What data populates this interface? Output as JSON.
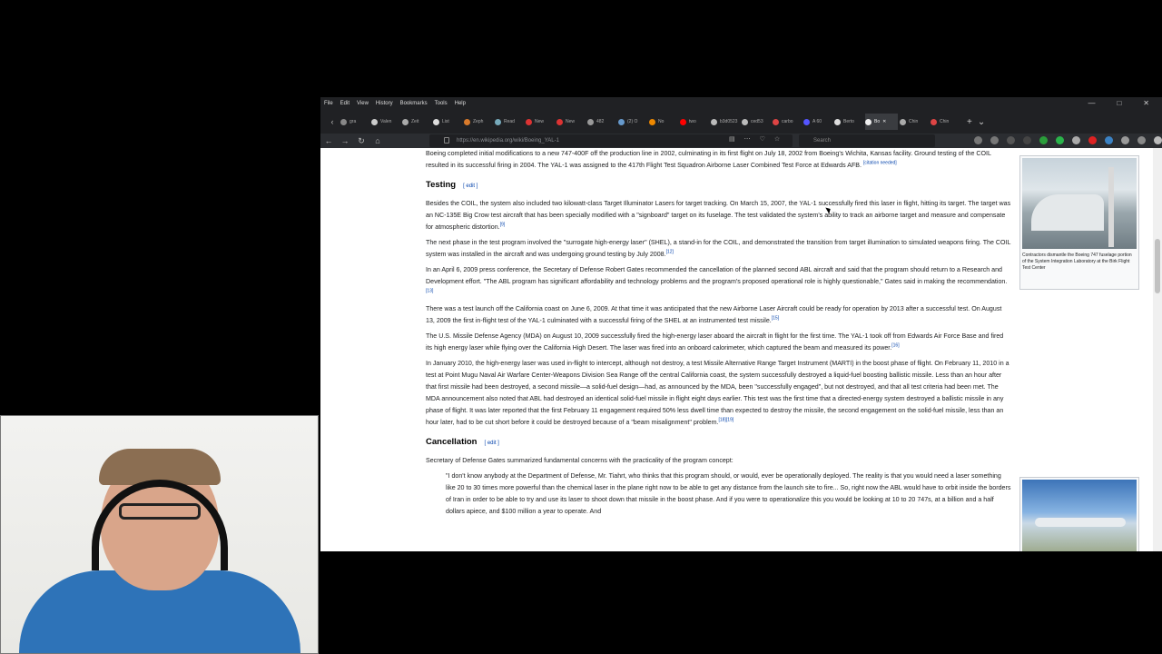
{
  "menubar": [
    "File",
    "Edit",
    "View",
    "History",
    "Bookmarks",
    "Tools",
    "Help"
  ],
  "tabs": [
    {
      "label": "gra",
      "color": "#888"
    },
    {
      "label": "Valen",
      "color": "#ccc"
    },
    {
      "label": "Zeit",
      "color": "#aaa"
    },
    {
      "label": "List",
      "color": "#ddd"
    },
    {
      "label": "Zeph",
      "color": "#d97a2b"
    },
    {
      "label": "Read",
      "color": "#7ab"
    },
    {
      "label": "New",
      "color": "#d33"
    },
    {
      "label": "New",
      "color": "#d33"
    },
    {
      "label": "482",
      "color": "#999"
    },
    {
      "label": "(2) O",
      "color": "#69c"
    },
    {
      "label": "No",
      "color": "#e80"
    },
    {
      "label": "two",
      "color": "#f00"
    },
    {
      "label": "b3d0523",
      "color": "#bbb"
    },
    {
      "label": "ced53",
      "color": "#bbb"
    },
    {
      "label": "carbo",
      "color": "#d44"
    },
    {
      "label": "A 60",
      "color": "#55f"
    },
    {
      "label": "Berto",
      "color": "#ddd"
    },
    {
      "label": "Bo",
      "color": "#eee",
      "active": true
    },
    {
      "label": "Chin",
      "color": "#aaa"
    },
    {
      "label": "Chin",
      "color": "#d44"
    }
  ],
  "nav": {
    "url": "https://en.wikipedia.org/wiki/Boeing_YAL-1",
    "search_placeholder": "Search"
  },
  "article": {
    "p_intro": "Boeing completed initial modifications to a new 747-400F off the production line in 2002, culminating in its first flight on July 18, 2002 from Boeing's Wichita, Kansas facility. Ground testing of the COIL resulted in its successful firing in 2004. The YAL-1 was assigned to the 417th Flight Test Squadron Airborne Laser Combined Test Force at Edwards AFB.",
    "p_intro_sup": "[citation needed]",
    "testing_heading": "Testing",
    "edit_label": "[ edit ]",
    "p_test1": "Besides the COIL, the system also included two kilowatt-class Target Illuminator Lasers for target tracking. On March 15, 2007, the YAL-1 successfully fired this laser in flight, hitting its target. The target was an NC-135E Big Crow test aircraft that has been specially modified with a \"signboard\" target on its fuselage. The test validated the system's ability to track an airborne target and measure and compensate for atmospheric distortion.",
    "p_test1_sup": "[9]",
    "p_test2": "The next phase in the test program involved the \"surrogate high-energy laser\" (SHEL), a stand-in for the COIL, and demonstrated the transition from target illumination to simulated weapons firing. The COIL system was installed in the aircraft and was undergoing ground testing by July 2008.",
    "p_test2_sup": "[12]",
    "p_test3": "In an April 6, 2009 press conference, the Secretary of Defense Robert Gates recommended the cancellation of the planned second ABL aircraft and said that the program should return to a Research and Development effort. \"The ABL program has significant affordability and technology problems and the program's proposed operational role is highly questionable,\" Gates said in making the recommendation.",
    "p_test3_sup": "[13]",
    "p_test4": "There was a test launch off the California coast on June 6, 2009. At that time it was anticipated that the new Airborne Laser Aircraft could be ready for operation by 2013 after a successful test. On August 13, 2009 the first in-flight test of the YAL-1 culminated with a successful firing of the SHEL at an instrumented test missile.",
    "p_test4_sup": "[15]",
    "p_test5": "The U.S. Missile Defense Agency (MDA) on August 10, 2009 successfully fired the high-energy laser aboard the aircraft in flight for the first time. The YAL-1 took off from Edwards Air Force Base and fired its high energy laser while flying over the California High Desert. The laser was fired into an onboard calorimeter, which captured the beam and measured its power.",
    "p_test5_sup": "[16]",
    "p_test6": "In January 2010, the high-energy laser was used in-flight to intercept, although not destroy, a test Missile Alternative Range Target Instrument (MARTI) in the boost phase of flight. On February 11, 2010 in a test at Point Mugu Naval Air Warfare Center-Weapons Division Sea Range off the central California coast, the system successfully destroyed a liquid-fuel boosting ballistic missile. Less than an hour after that first missile had been destroyed, a second missile—a solid-fuel design—had, as announced by the MDA, been \"successfully engaged\", but not destroyed, and that all test criteria had been met. The MDA announcement also noted that ABL had destroyed an identical solid-fuel missile in flight eight days earlier. This test was the first time that a directed-energy system destroyed a ballistic missile in any phase of flight. It was later reported that the first February 11 engagement required 50% less dwell time than expected to destroy the missile, the second engagement on the solid-fuel missile, less than an hour later, had to be cut short before it could be destroyed because of a \"beam misalignment\" problem.",
    "p_test6_sup": "[18][19]",
    "cancellation_heading": "Cancellation",
    "p_cancel1": "Secretary of Defense Gates summarized fundamental concerns with the practicality of the program concept:",
    "p_quote": "\"I don't know anybody at the Department of Defense, Mr. Tiahrt, who thinks that this program should, or would, ever be operationally deployed. The reality is that you would need a laser something like 20 to 30 times more powerful than the chemical laser in the plane right now to be able to get any distance from the launch site to fire... So, right now the ABL would have to orbit inside the borders of Iran in order to be able to try and use its laser to shoot down that missile in the boost phase. And if you were to operationalize this you would be looking at 10 to 20 747s, at a billion and a half dollars apiece, and $100 million a year to operate. And"
  },
  "figure1": {
    "caption": "Contractors dismantle the Boeing 747 fuselage portion of the System Integration Laboratory at the Birk Flight Test Center"
  }
}
